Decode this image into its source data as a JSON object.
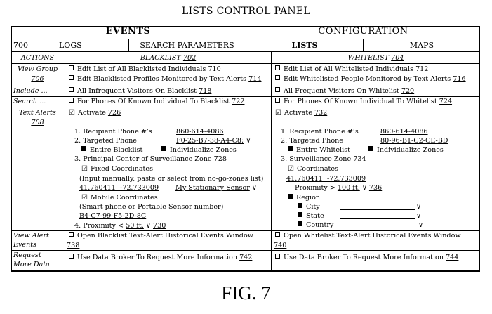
{
  "page_title": "LISTS CONTROL PANEL",
  "figure_label": "FIG. 7",
  "tabs": {
    "events": "EVENTS",
    "configuration": "CONFIGURATION"
  },
  "subtabs": {
    "ref": "700",
    "logs": "LOGS",
    "search_parameters": "SEARCH PARAMETERS",
    "lists": "LISTS",
    "maps": "MAPS"
  },
  "col_headers": {
    "actions": "ACTIONS",
    "blacklist": "BLACKLIST",
    "blacklist_ref": "702",
    "whitelist": "WHITELIST",
    "whitelist_ref": "704"
  },
  "rows": {
    "view_group": {
      "label": "View Group",
      "ref": "706"
    },
    "include": "Include ...",
    "search": "Search ...",
    "text_alerts": {
      "label": "Text Alerts",
      "ref": "708"
    },
    "view_alert": {
      "line1": "View Alert",
      "line2": "Events"
    },
    "request": {
      "line1": "Request",
      "line2": "More Data"
    }
  },
  "blacklist": {
    "edit_list": "Edit List of All Blacklisted Individuals",
    "edit_list_ref": "710",
    "edit_profiles": "Edit Blacklisted Profiles Monitored by Text Alerts",
    "edit_profiles_ref": "714",
    "include": "All Infrequent Visitors On Blacklist",
    "include_ref": "718",
    "search": "For Phones Of Known Individual To Blacklist",
    "search_ref": "722",
    "activate": "Activate",
    "activate_ref": "726",
    "recipient_label": "1. Recipient Phone #’s",
    "recipient_value": "860-614-4086",
    "targeted_label": "2. Targeted Phone",
    "targeted_value": "F0-25-B7-38-A4-C8;",
    "entire": "Entire Blacklist",
    "individualize": "Individualize Zones",
    "principal_label": "3. Principal Center of Surveillance Zone",
    "principal_ref": "728",
    "fixed": "Fixed Coordinates",
    "input_hint": "(Input manually, paste or select from no-go-zones list)",
    "coords": "41.760411, -72.733009",
    "sensor": "My Stationary Sensor",
    "mobile": "Mobile Coordinates",
    "smart_hint": "(Smart phone or Portable Sensor number)",
    "mobile_id": "B4-C7-99-F5-2D-8C",
    "proximity_label": "4. Proximity",
    "proximity_op": "<",
    "proximity_value": "50 ft.",
    "proximity_ref": "730",
    "open_window": "Open Blacklist Text-Alert Historical Events Window",
    "open_window_ref": "738",
    "broker": "Use Data Broker To Request More Information",
    "broker_ref": "742"
  },
  "whitelist": {
    "edit_list": "Edit List of All Whitelisted Individuals",
    "edit_list_ref": "712",
    "edit_profiles": "Edit Whitelisted People Monitored by Text Alerts",
    "edit_profiles_ref": "716",
    "include": "All Frequent Visitors On Whitelist",
    "include_ref": "720",
    "search": "For Phones Of Known Individual To Whitelist",
    "search_ref": "724",
    "activate": "Activate",
    "activate_ref": "732",
    "recipient_label": "1. Recipient Phone #’s",
    "recipient_value": "860-614-4086",
    "targeted_label": "2. Targeted Phone",
    "targeted_value": "80-96-B1-C2-CE-BD",
    "entire": "Entire Whitelist",
    "individualize": "Individualize Zones",
    "zone_label": "3. Surveillance Zone",
    "zone_ref": "734",
    "coordinates": "Coordinates",
    "coords": "41.760411, -72.733009",
    "proximity_label": "Proximity",
    "proximity_op": ">",
    "proximity_value": "100 ft.",
    "proximity_ref": "736",
    "region": "Region",
    "city": "City",
    "state": "State",
    "country": "Country",
    "open_window": "Open Whitelist Text-Alert Historical Events Window",
    "open_window_ref": "740",
    "broker": "Use Data Broker To Request More Information",
    "broker_ref": "744"
  },
  "glyphs": {
    "checked": "☑",
    "dropdown": "∨"
  }
}
